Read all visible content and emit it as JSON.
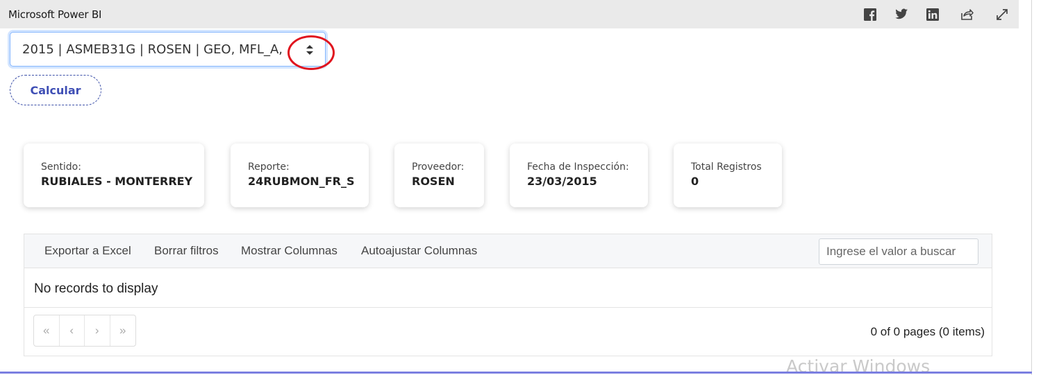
{
  "app": {
    "title": "Microsoft Power BI"
  },
  "share_icons": [
    "facebook-icon",
    "twitter-icon",
    "linkedin-icon",
    "share-icon",
    "expand-icon"
  ],
  "selector": {
    "value": "2015 | ASMEB31G | ROSEN | GEO, MFL_A,"
  },
  "calculate_button": {
    "label": "Calcular"
  },
  "cards": [
    {
      "label": "Sentido:",
      "value": "RUBIALES - MONTERREY"
    },
    {
      "label": "Reporte:",
      "value": "24RUBMON_FR_S"
    },
    {
      "label": "Proveedor:",
      "value": "ROSEN"
    },
    {
      "label": "Fecha de Inspección:",
      "value": "23/03/2015"
    },
    {
      "label": "Total Registros",
      "value": "0"
    }
  ],
  "grid": {
    "toolbar": {
      "export_excel": "Exportar a Excel",
      "clear_filters": "Borrar filtros",
      "show_columns": "Mostrar Columnas",
      "autofit_columns": "Autoajustar Columnas"
    },
    "search": {
      "placeholder": "Ingrese el valor a buscar"
    },
    "empty_message": "No records to display",
    "pager": {
      "first": "«",
      "prev": "‹",
      "next": "›",
      "last": "»",
      "info": "0 of 0 pages (0 items)"
    }
  },
  "colors": {
    "accent": "#3f4fb5",
    "highlight_circle": "#e0141e",
    "bottom_line": "#7b7fe0"
  },
  "watermark": {
    "text": "Activar Windows"
  }
}
